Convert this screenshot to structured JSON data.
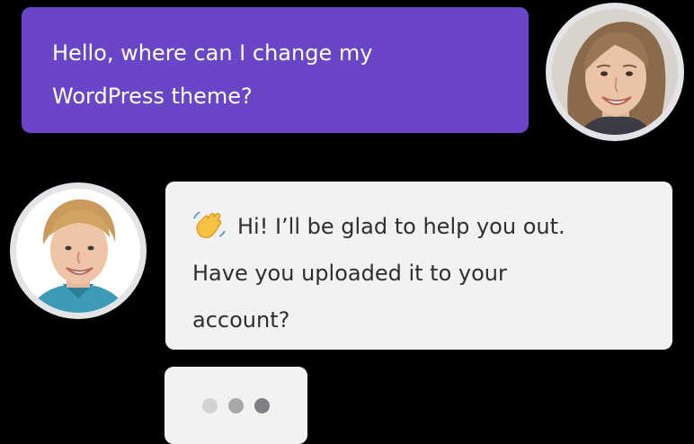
{
  "conversation": {
    "user_message": {
      "line1": "Hello, where can I change my",
      "line2": "WordPress theme?"
    },
    "agent_message": {
      "emoji": "waving-hand-icon",
      "line1": "Hi! I’ll be glad to help you out.",
      "line2": "Have you uploaded it to your",
      "line3": "account?"
    },
    "typing_indicator": {
      "dot_colors": [
        "#D2D2D4",
        "#A8A8AC",
        "#7F7F85"
      ]
    }
  },
  "colors": {
    "user_bubble": "#6B45C8",
    "agent_bubble": "#F2F2F2",
    "background": "#000000"
  }
}
